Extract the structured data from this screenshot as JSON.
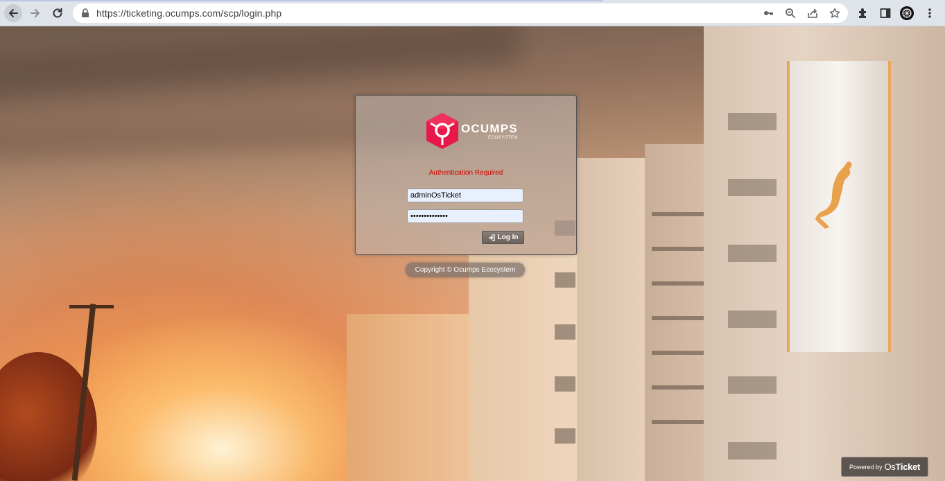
{
  "browser": {
    "url": "https://ticketing.ocumps.com/scp/login.php",
    "icons": [
      "back-arrow-icon",
      "forward-arrow-icon",
      "reload-icon",
      "lock-icon",
      "key-icon",
      "zoom-icon",
      "share-icon",
      "star-icon",
      "extensions-icon",
      "side-panel-icon",
      "profile-avatar",
      "kebab-menu-icon"
    ]
  },
  "login": {
    "logo_word": "OCUMPS",
    "logo_sub": "ECOSYSTEM",
    "auth_message": "Authentication Required",
    "username_value": "adminOsTicket",
    "password_value": "••••••••••••••",
    "login_button_label": "Log In",
    "colors": {
      "logo_red": "#e8194a",
      "error_red": "#d00000"
    }
  },
  "footer": {
    "copyright": "Copyright © Ocumps Ecosystem",
    "powered_by_prefix": "Powered by",
    "powered_by_brand_os": "Os",
    "powered_by_brand_ticket": "Ticket"
  }
}
